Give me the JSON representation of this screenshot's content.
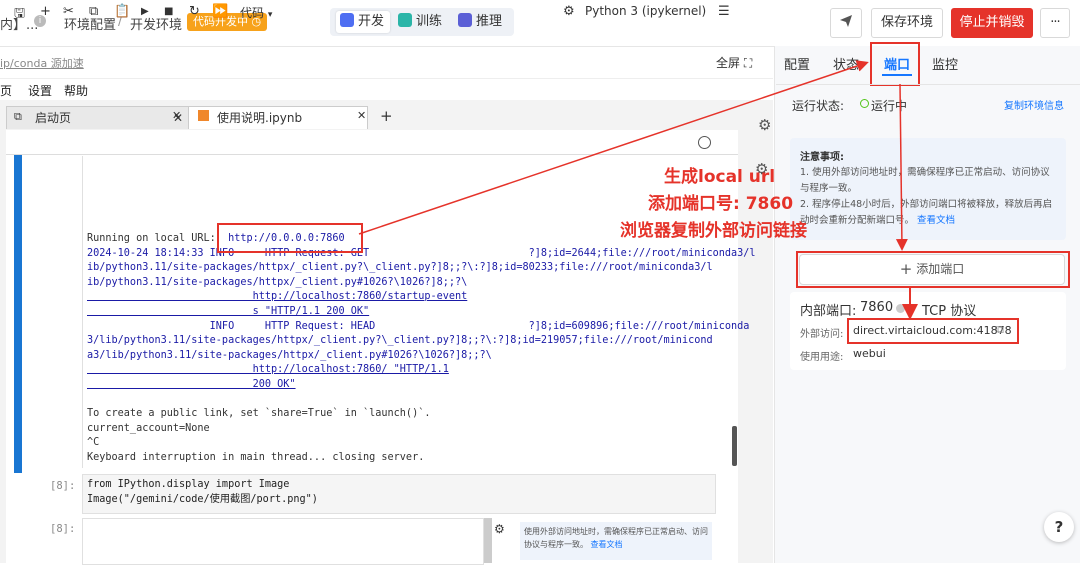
{
  "topbar": {
    "crumb_prefix": "内】...",
    "crumb_env": "环境配置",
    "crumb_sep1": "/",
    "crumb_dev": "开发环境",
    "dev_badge": "代码开发中",
    "modes": [
      "开发",
      "训练",
      "推理"
    ],
    "save_env": "保存环境",
    "stop_destroy": "停止并销毁",
    "more": "···"
  },
  "row2": {
    "conda_text": "ip/conda 源加速",
    "fullscreen": "全屏"
  },
  "menu": [
    "页",
    "设置",
    "帮助"
  ],
  "notebook": {
    "tabs": [
      "启动页",
      "使用说明.ipynb"
    ],
    "add_tab": "+",
    "cell_type": "代码",
    "kernel": "Python 3 (ipykernel)",
    "output_lines": [
      "Running on local URL:",
      "2024-10-24 18:14:33 INFO     HTTP Request: GET                          ?]8;id=2644;file:///root/miniconda3/l",
      "ib/python3.11/site-packages/httpx/_client.py?\\_client.py?]8;;?\\:?]8;id=80233;file:///root/miniconda3/l",
      "ib/python3.11/site-packages/httpx/_client.py#1026?\\1026?]8;;?\\",
      "                           http://localhost:7860/startup-event",
      "                           s \"HTTP/1.1 200 OK\"",
      "                    INFO     HTTP Request: HEAD                         ?]8;id=609896;file:///root/miniconda",
      "3/lib/python3.11/site-packages/httpx/_client.py?\\_client.py?]8;;?\\:?]8;id=219057;file:///root/minicond",
      "a3/lib/python3.11/site-packages/httpx/_client.py#1026?\\1026?]8;;?\\",
      "                           http://localhost:7860/ \"HTTP/1.1",
      "                           200 OK\"",
      "",
      "To create a public link, set `share=True` in `launch()`.",
      "current_account=None",
      "^C",
      "Keyboard interruption in main thread... closing server."
    ],
    "local_url": "http://0.0.0.0:7860",
    "cell8_prompt": "[8]:",
    "cell8_line1": "from IPython.display import Image",
    "cell8_line2": "Image(\"/gemini/code/使用截图/port.png\")",
    "cell9_prompt": "[8]:",
    "mini_note": "使用外部访问地址时，需确保程序已正常启动、访问协议与程序一致。",
    "mini_link": "查看文档"
  },
  "right": {
    "tabs": [
      "配置",
      "状态",
      "端口",
      "监控"
    ],
    "active_tab": "端口",
    "run_status_label": "运行状态:",
    "run_status": "运行中",
    "copy_env": "复制环境信息",
    "notice_title": "注意事项:",
    "notice_1": "1. 使用外部访问地址时，需确保程序已正常启动、访问协议与程序一致。",
    "notice_2": "2. 程序停止48小时后，外部访问端口将被释放，释放后再启动时会重新分配新端口号。",
    "notice_link": "查看文档",
    "add_port": "添加端口",
    "internal_port_label": "内部端口:",
    "internal_port": "7860",
    "protocol": "TCP 协议",
    "external_label": "外部访问:",
    "external_url": "direct.virtaicloud.com:41878",
    "usage_label": "使用用途:",
    "usage": "webui"
  },
  "annotations": {
    "line1": "生成local url",
    "line2": "添加端口号: 7860",
    "line3": "浏览器复制外部访问链接"
  },
  "help": "?",
  "colors": {
    "accent": "#1677ff",
    "danger": "#e5332a",
    "badge": "#f7a21b",
    "running": "#52c41a"
  }
}
